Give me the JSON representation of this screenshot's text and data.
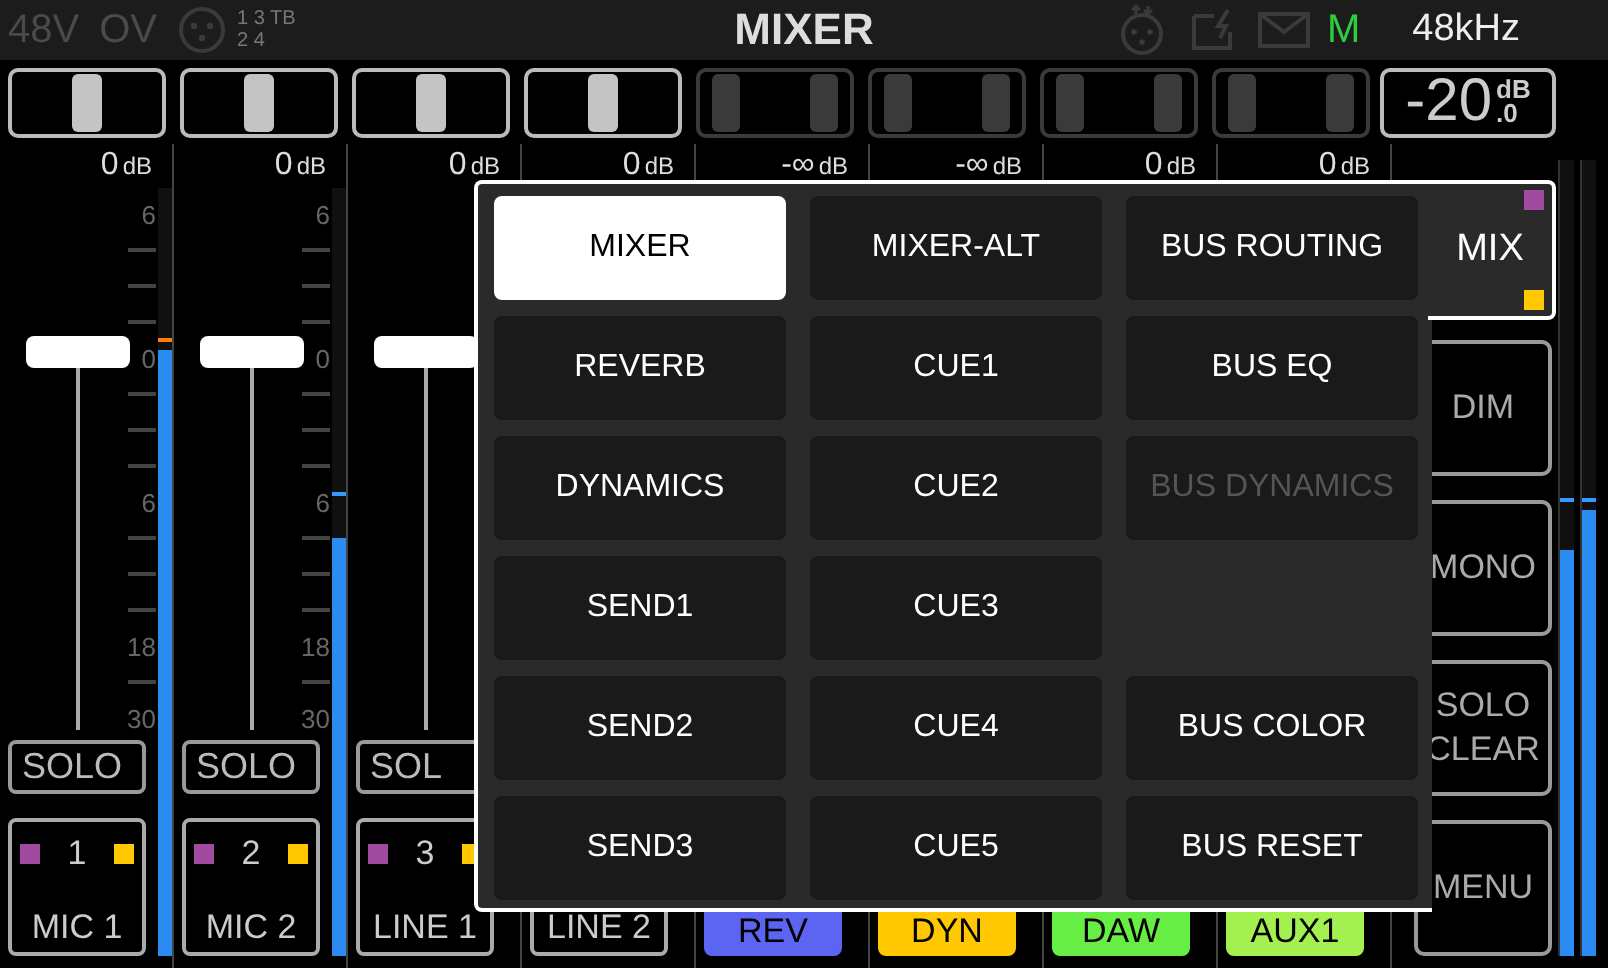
{
  "status_bar": {
    "phantom": "48V",
    "overload": "OV",
    "inputs_top": "1 3 TB",
    "inputs_bottom": "2 4",
    "title": "MIXER",
    "mode": "M",
    "sample_rate": "48kHz"
  },
  "pan_controls": [
    {
      "kind": "mono"
    },
    {
      "kind": "mono"
    },
    {
      "kind": "mono"
    },
    {
      "kind": "mono"
    },
    {
      "kind": "stereo"
    },
    {
      "kind": "stereo"
    },
    {
      "kind": "stereo"
    },
    {
      "kind": "stereo"
    }
  ],
  "output_level": {
    "value": "-20",
    "unit": "dB",
    "decimal": ".0"
  },
  "channels": [
    {
      "value": "0",
      "unit": "dB",
      "scale": [
        "6",
        "0",
        "6",
        "18",
        "30"
      ],
      "fader": {
        "level": 0.7
      },
      "meter": {
        "level": 0.79
      },
      "peak": {
        "level": 0.8
      },
      "solo": "SOLO",
      "number": "1",
      "name": "MIC 1"
    },
    {
      "value": "0",
      "unit": "dB",
      "scale": [
        "6",
        "0",
        "6",
        "18",
        "30"
      ],
      "fader": {
        "level": 0.7
      },
      "meter": {
        "level": 0.545
      },
      "peak": {
        "level": 0.6
      },
      "solo": "SOLO",
      "number": "2",
      "name": "MIC 2"
    },
    {
      "value": "0",
      "unit": "dB",
      "fader": {
        "level": 0.7
      },
      "solo": "SOL",
      "number": "3",
      "name": "LINE 1"
    },
    {
      "value": "0",
      "unit": "dB",
      "name": "LINE 2"
    },
    {
      "value": "-∞",
      "unit": "dB",
      "name": "REV",
      "color": "#5c64f2"
    },
    {
      "value": "-∞",
      "unit": "dB",
      "name": "DYN",
      "color": "#ffc800"
    },
    {
      "value": "0",
      "unit": "dB",
      "name": "DAW",
      "color": "#66ee44"
    },
    {
      "value": "0",
      "unit": "dB",
      "name": "AUX1",
      "color": "#a4f050"
    }
  ],
  "right_buttons": [
    "DIM",
    "MONO",
    "SOLO CLEAR",
    "MENU"
  ],
  "master_meters": [
    {
      "level": 0.51,
      "peak": {
        "level": 0.57
      }
    },
    {
      "level": 0.56,
      "peak": {
        "level": 0.57
      }
    }
  ],
  "menu": {
    "tab": "MIX",
    "items": [
      {
        "kind": "button",
        "label": "MIXER",
        "selected": true,
        "disabled": false
      },
      {
        "kind": "button",
        "label": "MIXER-ALT",
        "selected": false,
        "disabled": false
      },
      {
        "kind": "button",
        "label": "BUS ROUTING",
        "selected": false,
        "disabled": false
      },
      {
        "kind": "button",
        "label": "REVERB",
        "selected": false,
        "disabled": false
      },
      {
        "kind": "button",
        "label": "CUE1",
        "selected": false,
        "disabled": false
      },
      {
        "kind": "button",
        "label": "BUS EQ",
        "selected": false,
        "disabled": false
      },
      {
        "kind": "button",
        "label": "DYNAMICS",
        "selected": false,
        "disabled": false
      },
      {
        "kind": "button",
        "label": "CUE2",
        "selected": false,
        "disabled": false
      },
      {
        "kind": "button",
        "label": "BUS DYNAMICS",
        "selected": false,
        "disabled": true
      },
      {
        "kind": "button",
        "label": "SEND1",
        "selected": false,
        "disabled": false
      },
      {
        "kind": "button",
        "label": "CUE3",
        "selected": false,
        "disabled": false
      },
      {
        "kind": "spacer"
      },
      {
        "kind": "button",
        "label": "SEND2",
        "selected": false,
        "disabled": false
      },
      {
        "kind": "button",
        "label": "CUE4",
        "selected": false,
        "disabled": false
      },
      {
        "kind": "button",
        "label": "BUS COLOR",
        "selected": false,
        "disabled": false
      },
      {
        "kind": "button",
        "label": "SEND3",
        "selected": false,
        "disabled": false
      },
      {
        "kind": "button",
        "label": "CUE5",
        "selected": false,
        "disabled": false
      },
      {
        "kind": "button",
        "label": "BUS RESET",
        "selected": false,
        "disabled": false
      }
    ]
  }
}
